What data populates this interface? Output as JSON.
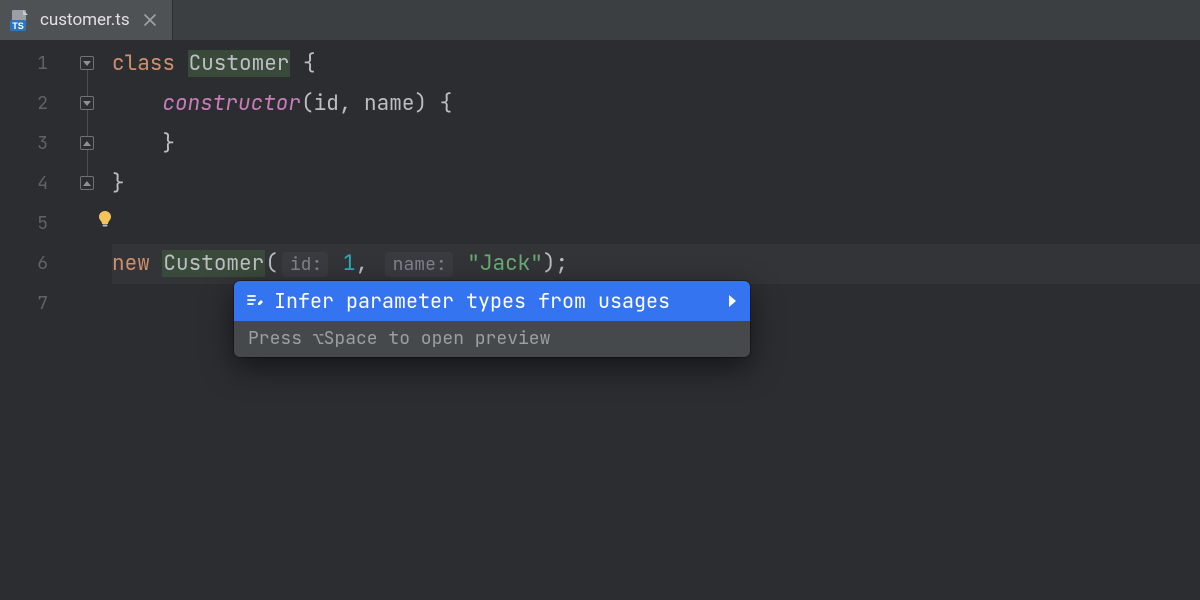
{
  "tab": {
    "filename": "customer.ts",
    "icon_name": "typescript-file-icon"
  },
  "gutter": {
    "lines": [
      "1",
      "2",
      "3",
      "4",
      "5",
      "6",
      "7"
    ]
  },
  "code": {
    "l1_kw": "class",
    "l1_cls": "Customer",
    "l1_tail": " {",
    "l2_fn": "constructor",
    "l2_p1": "id",
    "l2_p2": "name",
    "l2_open": "(",
    "l2_sep": ", ",
    "l2_close": ") {",
    "l3": "    }",
    "l4": "}",
    "l6_kw": "new",
    "l6_cls": "Customer",
    "l6_open": "(",
    "l6_hint1": "id:",
    "l6_val1": "1",
    "l6_sep": ", ",
    "l6_hint2": "name:",
    "l6_val2": "\"Jack\"",
    "l6_close": ");"
  },
  "bulb": {
    "name": "intention-bulb-icon"
  },
  "intention": {
    "item_label": "Infer parameter types from usages",
    "hint": "Press ⌥Space to open preview"
  },
  "colors": {
    "accent": "#3574f0",
    "bulb": "#f2c55c"
  }
}
